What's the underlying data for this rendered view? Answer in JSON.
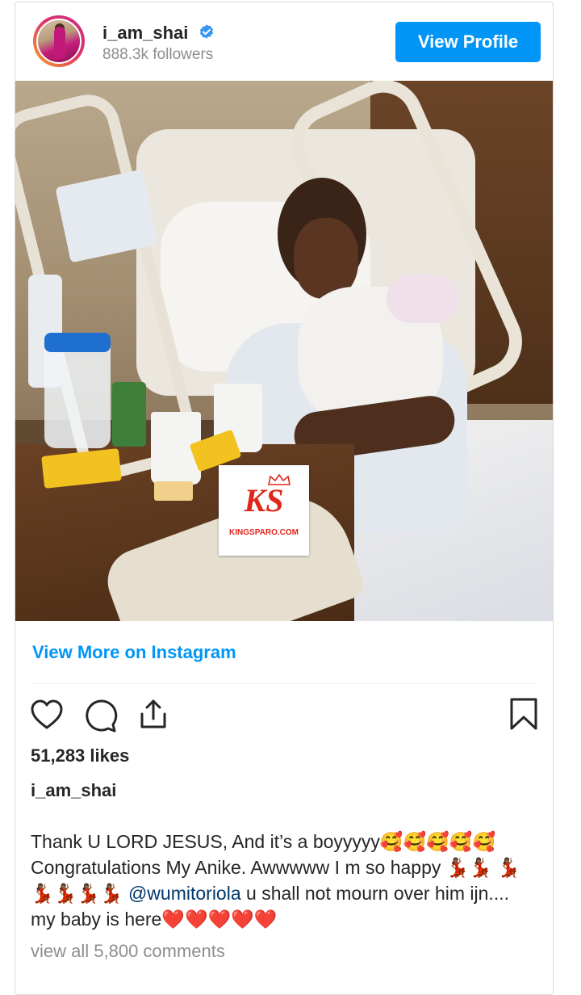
{
  "header": {
    "username": "i_am_shai",
    "followers": "888.3k followers",
    "view_profile_label": "View Profile"
  },
  "post": {
    "watermark": {
      "logo_text": "KS",
      "site": "KINGSPARO.COM"
    },
    "view_more_label": "View More on Instagram",
    "likes": "51,283 likes",
    "caption_user": "i_am_shai",
    "caption_part1": "Thank U LORD JESUS, And it’s a boyyyyy🥰🥰🥰🥰🥰 Congratulations My Anike. Awwwww I m so happy 💃🏾💃🏾 💃🏾💃🏾💃🏾💃🏾💃🏾 ",
    "caption_mention": "@wumitoriola",
    "caption_part2": " u shall not mourn over him ijn.... my baby is here❤️❤️❤️❤️❤️",
    "view_all_comments": "view all 5,800 comments"
  },
  "colors": {
    "accent": "#0095f6",
    "secondary_text": "#8e8e8e",
    "watermark_red": "#e0261b"
  },
  "icons": [
    "verified-badge-icon",
    "heart-icon",
    "comment-icon",
    "share-icon",
    "bookmark-icon",
    "crown-icon"
  ]
}
